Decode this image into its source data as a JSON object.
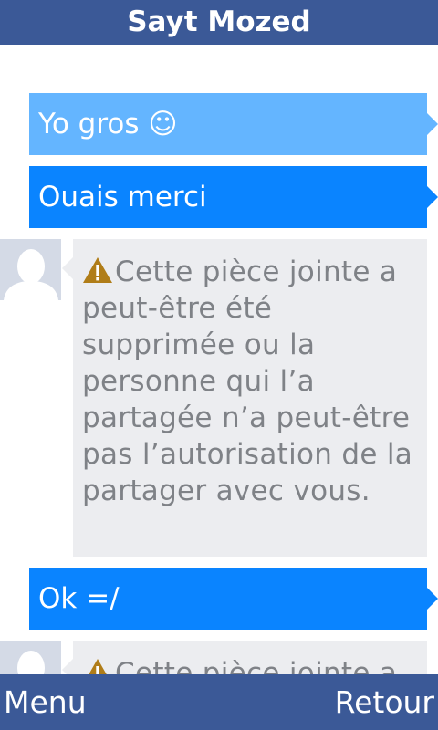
{
  "header": {
    "title": "Sayt Mozed"
  },
  "messages": [
    {
      "direction": "outgoing",
      "text": "Yo gros ☺"
    },
    {
      "direction": "outgoing",
      "text": "Ouais merci"
    },
    {
      "direction": "incoming",
      "icon": "warning-icon",
      "text": "Cette pièce jointe a peut-être été supprimée ou la personne qui l’a partagée n’a peut-être pas l’autorisation de la partager avec vous."
    },
    {
      "direction": "outgoing",
      "text": "Ok =/"
    },
    {
      "direction": "incoming",
      "icon": "warning-icon",
      "text": "Cette pièce jointe a"
    }
  ],
  "softkeys": {
    "left": "Menu",
    "right": "Retour"
  },
  "colors": {
    "bar": "#3b5997",
    "outgoing_light": "#64b5ff",
    "outgoing": "#0a84ff",
    "incoming_bg": "#ecedf0",
    "warning": "#b07d18"
  }
}
